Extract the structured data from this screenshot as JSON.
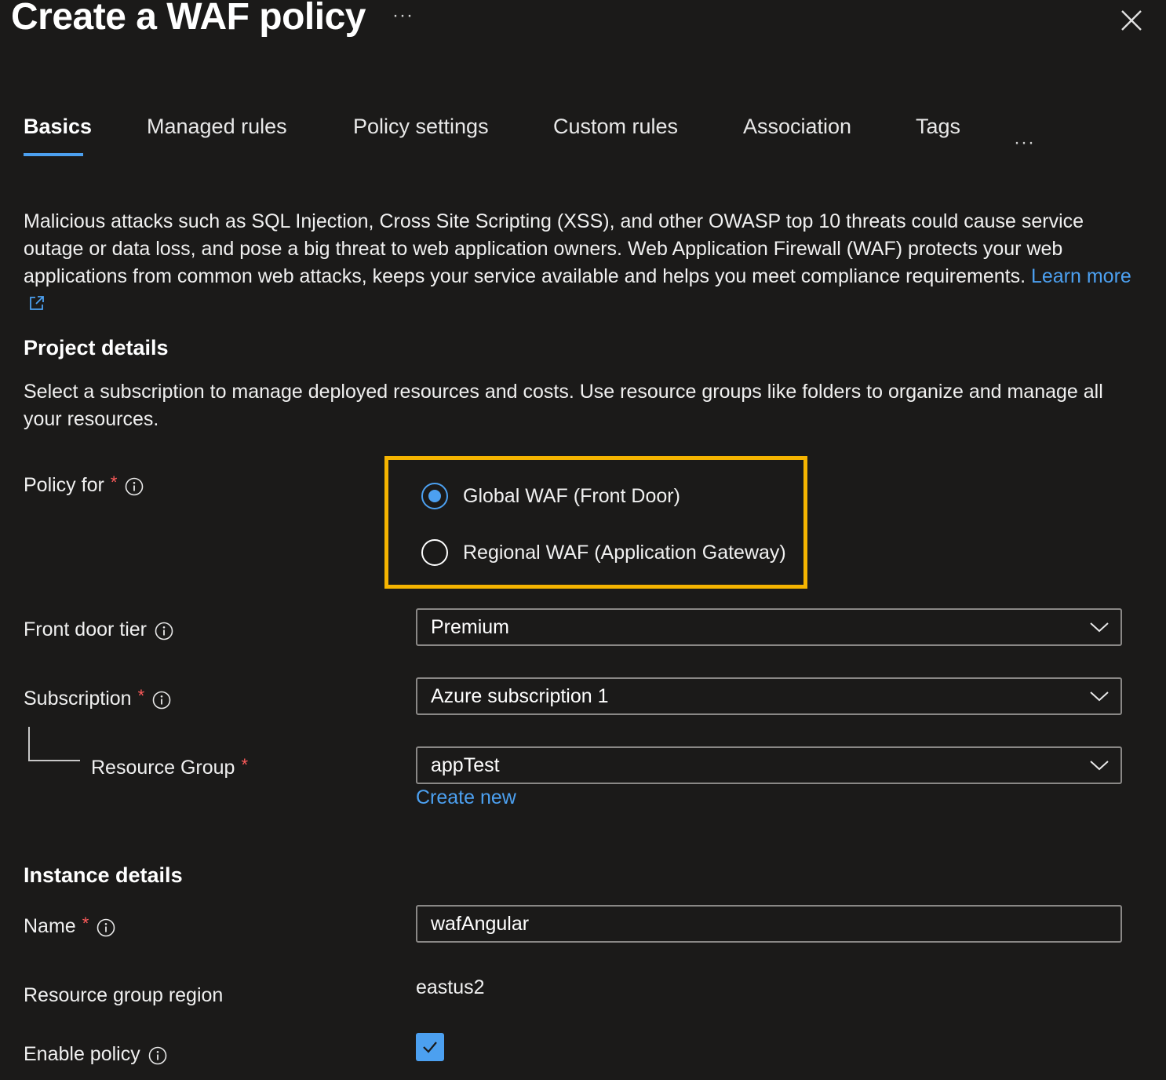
{
  "header": {
    "title": "Create a WAF policy",
    "more": "···"
  },
  "tabs": {
    "items": [
      {
        "label": "Basics",
        "active": true
      },
      {
        "label": "Managed rules"
      },
      {
        "label": "Policy settings"
      },
      {
        "label": "Custom rules"
      },
      {
        "label": "Association"
      },
      {
        "label": "Tags"
      }
    ],
    "overflow": "···"
  },
  "intro": {
    "text": "Malicious attacks such as SQL Injection, Cross Site Scripting (XSS), and other OWASP top 10 threats could cause service outage or data loss, and pose a big threat to web application owners. Web Application Firewall (WAF) protects your web applications from common web attacks, keeps your service available and helps you meet compliance requirements. ",
    "link": "Learn more"
  },
  "project": {
    "heading": "Project details",
    "description": "Select a subscription to manage deployed resources and costs. Use resource groups like folders to organize and manage all your resources."
  },
  "policy_for": {
    "label": "Policy for",
    "required": "*",
    "options": [
      {
        "label": "Global WAF (Front Door)",
        "selected": true
      },
      {
        "label": "Regional WAF (Application Gateway)",
        "selected": false
      }
    ]
  },
  "front_door_tier": {
    "label": "Front door tier",
    "value": "Premium"
  },
  "subscription": {
    "label": "Subscription",
    "required": "*",
    "value": "Azure subscription 1"
  },
  "resource_group": {
    "label": "Resource Group",
    "required": "*",
    "value": "appTest",
    "create_new": "Create new"
  },
  "instance": {
    "heading": "Instance details",
    "name_label": "Name",
    "name_required": "*",
    "name_value": "wafAngular",
    "region_label": "Resource group region",
    "region_value": "eastus2",
    "enable_label": "Enable policy",
    "enable_checked": true
  },
  "colors": {
    "background": "#1b1a19",
    "accent": "#4ca0f0",
    "highlight": "#f5b400",
    "required": "#ff5b5b"
  },
  "icons": [
    "more-icon",
    "close-icon",
    "external-link-icon",
    "info-icon",
    "chevron-down-icon",
    "checkmark-icon"
  ]
}
